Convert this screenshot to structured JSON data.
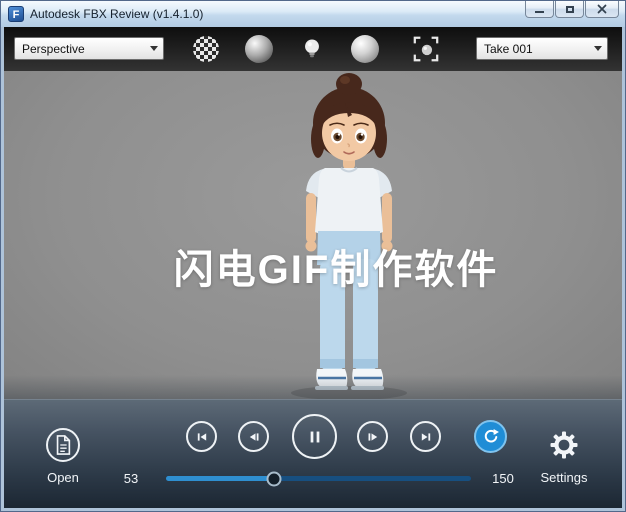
{
  "window": {
    "title": "Autodesk FBX Review (v1.4.1.0)",
    "icon_letter": "F"
  },
  "toolbar": {
    "view_mode": "Perspective",
    "take": "Take 001",
    "icons": [
      "checker-texture",
      "shaded-sphere",
      "lighting-bulb",
      "material-sphere",
      "frame-all"
    ]
  },
  "viewport": {
    "watermark": "闪电GIF制作软件"
  },
  "playback": {
    "open_label": "Open",
    "settings_label": "Settings",
    "current_frame": "53",
    "end_frame": "150"
  },
  "colors": {
    "accent_blue": "#1f8dd6",
    "viewport_bg": "#8f8f8f",
    "playbar_top": "#5d6a77",
    "playbar_bottom": "#1c2733"
  }
}
